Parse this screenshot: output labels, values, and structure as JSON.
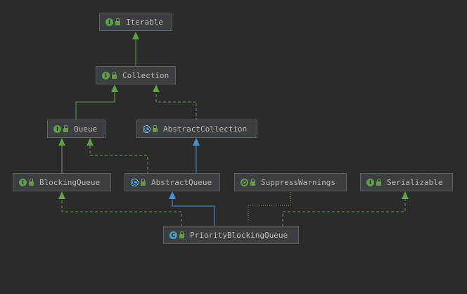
{
  "colors": {
    "background": "#2b2b2b",
    "node_bg": "#3c3f41",
    "node_border": "#5e6060",
    "text": "#bbbbbb",
    "extends_interface": "#5f9f4a",
    "extends_class": "#4c8fd6",
    "annotation_link": "#a0a060"
  },
  "nodes": [
    {
      "id": "iterable",
      "kind": "interface",
      "icon": "I",
      "label": "Iterable"
    },
    {
      "id": "collection",
      "kind": "interface",
      "icon": "I",
      "label": "Collection"
    },
    {
      "id": "queue",
      "kind": "interface",
      "icon": "I",
      "label": "Queue"
    },
    {
      "id": "abstractcollection",
      "kind": "abstract",
      "icon": "C",
      "label": "AbstractCollection"
    },
    {
      "id": "blockingqueue",
      "kind": "interface",
      "icon": "I",
      "label": "BlockingQueue"
    },
    {
      "id": "abstractqueue",
      "kind": "abstract",
      "icon": "C",
      "label": "AbstractQueue"
    },
    {
      "id": "suppresswarnings",
      "kind": "annotation",
      "icon": "@",
      "label": "SuppressWarnings"
    },
    {
      "id": "serializable",
      "kind": "interface",
      "icon": "I",
      "label": "Serializable"
    },
    {
      "id": "priorityblockingqueue",
      "kind": "class",
      "icon": "C",
      "label": "PriorityBlockingQueue"
    }
  ],
  "edges": [
    {
      "from": "collection",
      "to": "iterable",
      "type": "extends-interface"
    },
    {
      "from": "queue",
      "to": "collection",
      "type": "extends-interface"
    },
    {
      "from": "abstractcollection",
      "to": "collection",
      "type": "implements"
    },
    {
      "from": "blockingqueue",
      "to": "queue",
      "type": "extends-interface"
    },
    {
      "from": "abstractqueue",
      "to": "queue",
      "type": "implements"
    },
    {
      "from": "abstractqueue",
      "to": "abstractcollection",
      "type": "extends-class"
    },
    {
      "from": "priorityblockingqueue",
      "to": "blockingqueue",
      "type": "implements"
    },
    {
      "from": "priorityblockingqueue",
      "to": "abstractqueue",
      "type": "extends-class"
    },
    {
      "from": "priorityblockingqueue",
      "to": "suppresswarnings",
      "type": "annotated"
    },
    {
      "from": "priorityblockingqueue",
      "to": "serializable",
      "type": "implements"
    }
  ]
}
